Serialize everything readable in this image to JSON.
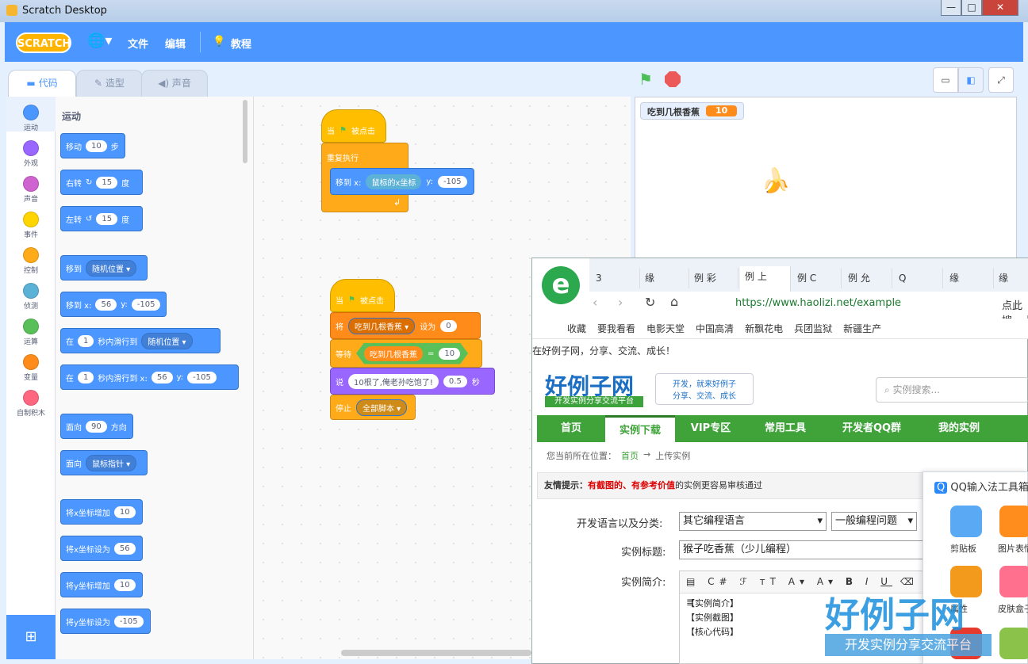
{
  "window": {
    "title": "Scratch Desktop",
    "controls": [
      "—",
      "□",
      "✕"
    ]
  },
  "menubar": {
    "logo": "SCRATCH",
    "items": [
      "文件",
      "编辑"
    ],
    "tutorial": "教程",
    "globe": "globe-icon"
  },
  "tabs": [
    {
      "label": "代码"
    },
    {
      "label": "造型"
    },
    {
      "label": "声音"
    }
  ],
  "categories": [
    {
      "label": "运动",
      "color": "#4c97ff"
    },
    {
      "label": "外观",
      "color": "#9966ff"
    },
    {
      "label": "声音",
      "color": "#cf63cf"
    },
    {
      "label": "事件",
      "color": "#ffd500"
    },
    {
      "label": "控制",
      "color": "#ffab19"
    },
    {
      "label": "侦测",
      "color": "#5cb1d6"
    },
    {
      "label": "运算",
      "color": "#59c059"
    },
    {
      "label": "变量",
      "color": "#ff8c1a"
    },
    {
      "label": "自制积木",
      "color": "#ff6680"
    }
  ],
  "palette": {
    "heading": "运动",
    "move": {
      "a": "移动",
      "v": "10",
      "b": "步"
    },
    "turn_right": {
      "a": "右转",
      "v": "15",
      "b": "度"
    },
    "turn_left": {
      "a": "左转",
      "v": "15",
      "b": "度"
    },
    "goto": {
      "a": "移到",
      "dd": "随机位置"
    },
    "goto_xy": {
      "a": "移到 x:",
      "x": "56",
      "yl": "y:",
      "y": "-105"
    },
    "glide": {
      "a": "在",
      "v": "1",
      "b": "秒内滑行到",
      "dd": "随机位置"
    },
    "glide_xy": {
      "a": "在",
      "v": "1",
      "b": "秒内滑行到 x:",
      "x": "56",
      "yl": "y:",
      "y": "-105"
    },
    "point": {
      "a": "面向",
      "v": "90",
      "b": "方向"
    },
    "point_towards": {
      "a": "面向",
      "dd": "鼠标指针"
    },
    "change_x": {
      "a": "将x坐标增加",
      "v": "10"
    },
    "set_x": {
      "a": "将x坐标设为",
      "v": "56"
    },
    "change_y": {
      "a": "将y坐标增加",
      "v": "10"
    },
    "set_y": {
      "a": "将y坐标设为",
      "v": "-105"
    }
  },
  "script1": {
    "hat": "当",
    "hat2": "被点击",
    "forever": "重复执行",
    "goto": "移到 x:",
    "reporter": "鼠标的x坐标",
    "yl": "y:",
    "y": "-105"
  },
  "script2": {
    "hat": "当",
    "hat2": "被点击",
    "set": "将",
    "var": "吃到几根香蕉",
    "setto": "设为",
    "setv": "0",
    "wait": "等待",
    "waitvar": "吃到几根香蕉",
    "eq": "=",
    "eqv": "10",
    "say": "说",
    "saytext": "10根了,俺老孙吃饱了!",
    "sayv": "0.5",
    "sayunit": "秒",
    "stop": "停止",
    "stopdd": "全部脚本"
  },
  "stage": {
    "monitor_label": "吃到几根香蕉",
    "monitor_value": "10"
  },
  "browser": {
    "tabs": [
      "3",
      "缘",
      "例 彩",
      "例 上",
      "例 C",
      "例 允",
      "Q",
      "缘",
      "缘"
    ],
    "url": "https://www.haolizi.net/example",
    "url_right": "点此搜",
    "bookmarks": [
      "收藏",
      "要我看看",
      "电影天堂",
      "中国高清",
      "新飘花电",
      "兵团监狱",
      "新疆生产"
    ],
    "slogan": "在好例子网，分享、交流、成长！",
    "logo": "好例子网",
    "logo_sub": "开发实例分享交流平台",
    "logo_tag1": "开发，就来好例子",
    "logo_tag2": "分享、交流、成长",
    "search_placeholder": "实例搜索...",
    "nav": [
      "首页",
      "实例下载",
      "VIP专区",
      "常用工具",
      "开发者QQ群",
      "我的实例"
    ],
    "crumb_label": "您当前所在位置：",
    "crumb_home": "首页",
    "crumb_arrow": "→",
    "crumb_cur": "上传实例",
    "tip_label": "友情提示：",
    "tip_red": "有截图的、有参考价值",
    "tip_rest": "的实例更容易审核通过",
    "lang_label": "开发语言以及分类:",
    "lang_val": "其它编程语言",
    "cat_val": "一般编程问题",
    "title_label": "实例标题:",
    "title_val": "猴子吃香蕉（少儿编程）",
    "desc_label": "实例简介:",
    "desc_lines": [
      "【实例简介】",
      "【实例截图】",
      "【核心代码】"
    ]
  },
  "qq": {
    "title": "QQ输入法工具箱",
    "items": [
      {
        "label": "剪贴板"
      },
      {
        "label": "图片表情"
      },
      {
        "label": "属性"
      },
      {
        "label": "皮肤盒子"
      }
    ]
  },
  "watermark": {
    "big": "好例子网",
    "small": "开发实例分享交流平台"
  }
}
